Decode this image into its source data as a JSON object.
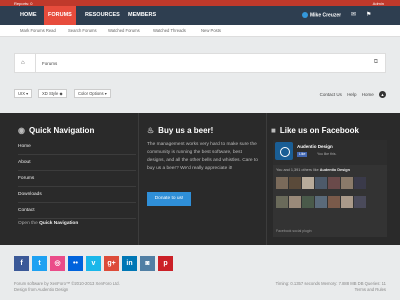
{
  "topbar": {
    "left": "Reports: 0",
    "right": "Admin"
  },
  "nav": {
    "tabs": [
      "HOME",
      "FORUMS",
      "RESOURCES",
      "MEMBERS"
    ],
    "user": "Mike Creuzer",
    "icons": [
      "inbox-icon",
      "flag-icon"
    ]
  },
  "subnav": {
    "items": [
      "Mark Forums Read",
      "Search Forums",
      "Watched Forums",
      "Watched Threads",
      "New Posts"
    ]
  },
  "breadcrumb": {
    "label": "Forums"
  },
  "controls": {
    "width": "UIX ▾",
    "style": "XD Style ◆",
    "color": "Color Options ▾",
    "links": [
      "Contact Us",
      "Help",
      "Home"
    ]
  },
  "footer": {
    "quick_nav": {
      "title": "Quick Navigation",
      "items": [
        "Home",
        "About",
        "Forums",
        "Downloads",
        "Contact"
      ],
      "open_prefix": "Open the",
      "open_bold": "Quick Navigation"
    },
    "beer": {
      "title": "Buy us a beer!",
      "text": "The management works very hard to make sure the community is running the best software, best designs, and all the other bells and whistles. Care to buy us a beer? We'd really appreciate it!",
      "button": "Donate to us!"
    },
    "facebook": {
      "title": "Like us on Facebook",
      "page_name": "Audentio Design",
      "like_label": "Like",
      "like_count": "You like this.",
      "people_prefix": "You and 1,391 others like",
      "people_bold": "Audentio Design",
      "plugin_label": "Facebook social plugin"
    }
  },
  "social_icons": [
    {
      "name": "facebook-icon",
      "glyph": "f",
      "color": "#3b5998"
    },
    {
      "name": "twitter-icon",
      "glyph": "t",
      "color": "#1da1f2"
    },
    {
      "name": "dribbble-icon",
      "glyph": "◎",
      "color": "#ea4c89"
    },
    {
      "name": "flickr-icon",
      "glyph": "••",
      "color": "#0063dc"
    },
    {
      "name": "vimeo-icon",
      "glyph": "v",
      "color": "#1ab7ea"
    },
    {
      "name": "google-plus-icon",
      "glyph": "g+",
      "color": "#dd4b39"
    },
    {
      "name": "linkedin-icon",
      "glyph": "in",
      "color": "#0077b5"
    },
    {
      "name": "instagram-icon",
      "glyph": "◙",
      "color": "#517fa4"
    },
    {
      "name": "pinterest-icon",
      "glyph": "p",
      "color": "#cb2027"
    }
  ],
  "copyright": {
    "line1": "Forum software by XenForo™ ©2010-2013 XenForo Ltd.",
    "line2": "Design from Audentio Design"
  },
  "stats": {
    "line1": "Timing: 0.1357 seconds Memory: 7.888 MB DB Queries: 11",
    "line2": "Terms and Rules"
  },
  "colors": {
    "top_red": "#c0392b",
    "nav_bg": "#2e3e50",
    "active_tab": "#e74c3c",
    "footer_bg": "#2a2a2a",
    "donate_blue": "#2f8fd8"
  }
}
